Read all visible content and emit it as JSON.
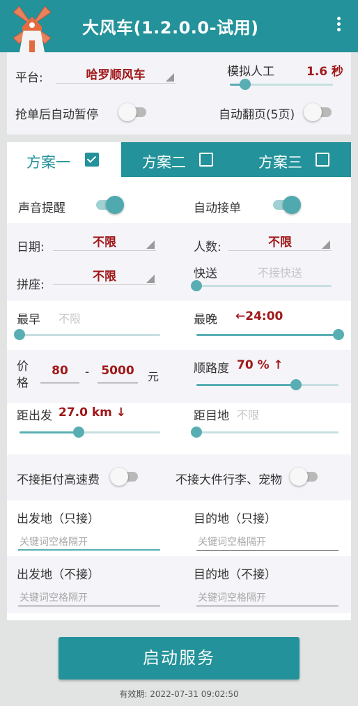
{
  "header": {
    "title": "大风车(1.2.0.0-试用)",
    "logo_icon": "windmill-logo",
    "menu_icon": "more-vert-icon"
  },
  "top": {
    "platform_label": "平台:",
    "platform_value": "哈罗顺风车",
    "sim_label": "模拟人工",
    "sim_value": "1.6 秒",
    "sim_level_pct": 15,
    "auto_pause_label": "抢单后自动暂停",
    "auto_pause_on": false,
    "auto_page_label": "自动翻页(5页)",
    "auto_page_on": false
  },
  "tabs": [
    {
      "label": "方案一",
      "checked": true
    },
    {
      "label": "方案二",
      "checked": false
    },
    {
      "label": "方案三",
      "checked": false
    }
  ],
  "plan": {
    "sound_label": "声音提醒",
    "sound_on": true,
    "auto_accept_label": "自动接单",
    "auto_accept_on": true,
    "date_label": "日期:",
    "date_value": "不限",
    "people_label": "人数:",
    "people_value": "不限",
    "carpool_label": "拼座:",
    "carpool_value": "不限",
    "express_label": "快送",
    "express_value": "不接快送",
    "express_level_pct": 0,
    "earliest_label": "最早",
    "earliest_value": "不限",
    "earliest_pct": 0,
    "latest_label": "最晚",
    "latest_value": "←24:00",
    "latest_pct": 100,
    "price_label": "价格",
    "price_min": "80",
    "price_dash": "-",
    "price_max": "5000",
    "price_unit": "元",
    "route_label": "顺路度",
    "route_value": "70 % ↑",
    "route_pct": 70,
    "dist_start_label": "距出发",
    "dist_start_value": "27.0 km ↓",
    "dist_start_pct": 42,
    "dist_dest_label": "距目地",
    "dist_dest_value": "不限",
    "dist_dest_pct": 0,
    "no_toll_label": "不接拒付高速费",
    "no_toll_on": false,
    "no_luggage_label": "不接大件行李、宠物",
    "no_luggage_on": false,
    "origin_only_label": "出发地（只接）",
    "origin_only_placeholder": "关键词空格隔开",
    "dest_only_label": "目的地（只接）",
    "dest_only_placeholder": "关键词空格隔开",
    "origin_exclude_label": "出发地（不接）",
    "origin_exclude_placeholder": "关键词空格隔开",
    "dest_exclude_label": "目的地（不接）",
    "dest_exclude_placeholder": "关键词空格隔开"
  },
  "start_button": "启动服务",
  "expiry": "有效期: 2022-07-31 09:02:50",
  "colors": {
    "primary": "#23929a",
    "accent_red": "#a01818",
    "slider": "#58aeb2"
  }
}
